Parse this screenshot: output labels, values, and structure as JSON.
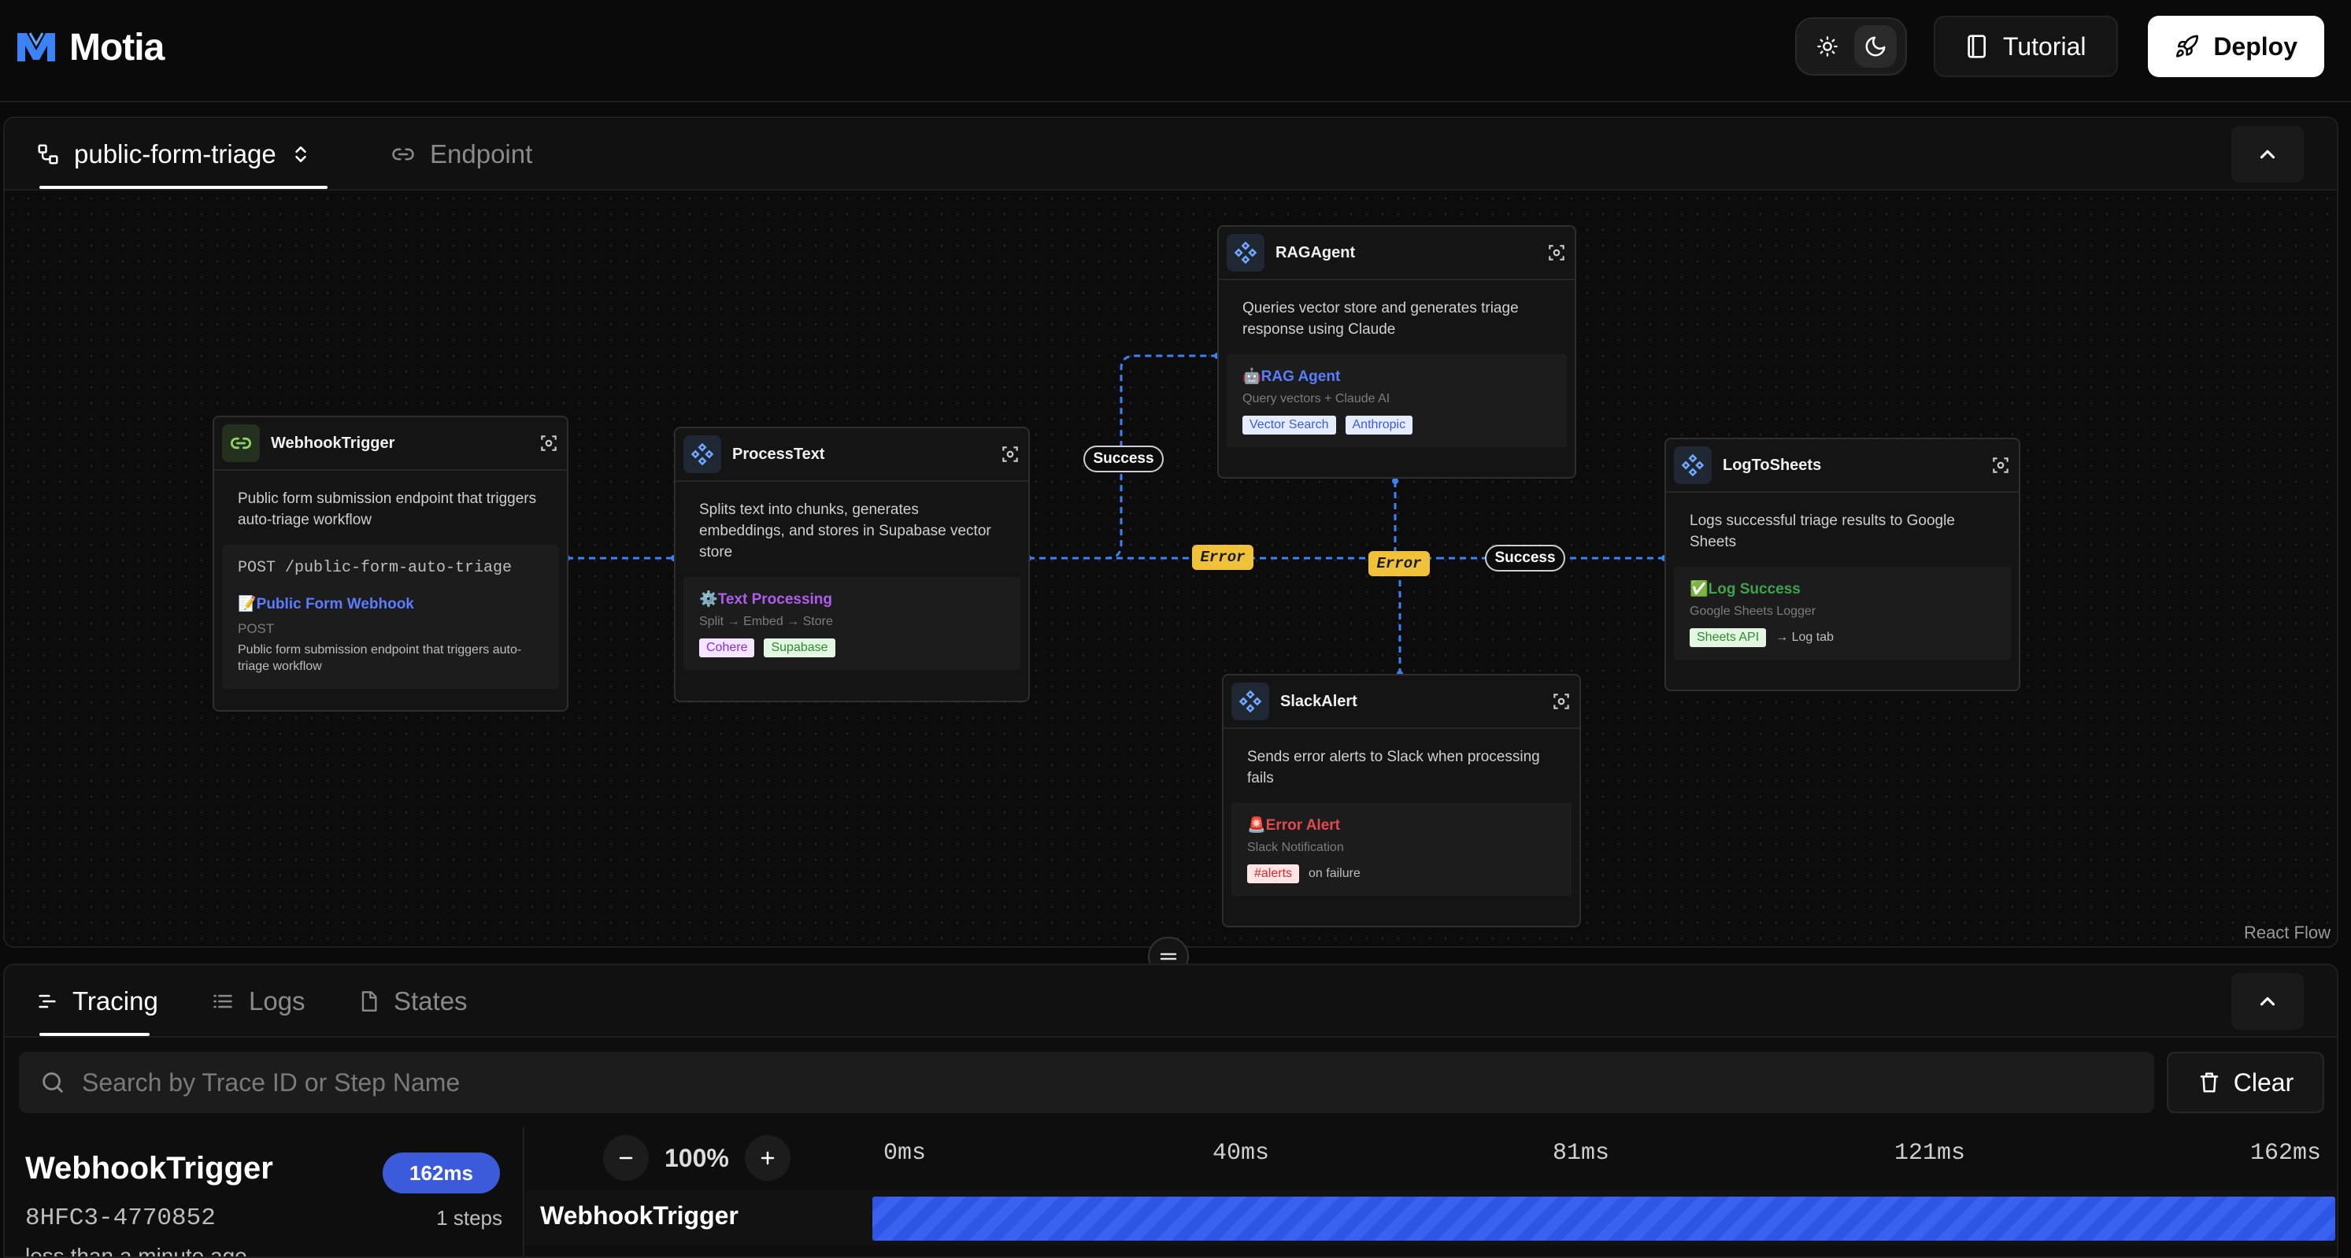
{
  "app": {
    "name": "Motia",
    "tutorial_label": "Tutorial",
    "deploy_label": "Deploy",
    "theme_light_icon": "sun-icon",
    "theme_dark_icon": "moon-icon"
  },
  "flow": {
    "tabs": [
      {
        "label": "public-form-triage",
        "icon": "flow-icon",
        "active": true
      },
      {
        "label": "Endpoint",
        "icon": "link-icon",
        "active": false
      }
    ],
    "react_flow_label": "React Flow",
    "nodes": {
      "webhook": {
        "title": "WebhookTrigger",
        "description": "Public form submission endpoint that triggers auto-triage workflow",
        "route": "POST /public-form-auto-triage",
        "inner_title": "📝Public Form Webhook",
        "inner_method": "POST",
        "inner_desc": "Public form submission endpoint that triggers auto-triage workflow"
      },
      "process": {
        "title": "ProcessText",
        "description": "Splits text into chunks, generates embeddings, and stores in Supabase vector store",
        "inner_title": "⚙️Text Processing",
        "inner_sub": "Split → Embed → Store",
        "tags": [
          "Cohere",
          "Supabase"
        ]
      },
      "rag": {
        "title": "RAGAgent",
        "description": "Queries vector store and generates triage response using Claude",
        "inner_title": "🤖RAG Agent",
        "inner_sub": "Query vectors + Claude AI",
        "tags": [
          "Vector Search",
          "Anthropic"
        ]
      },
      "slack": {
        "title": "SlackAlert",
        "description": "Sends error alerts to Slack when processing fails",
        "inner_title": "🚨Error Alert",
        "inner_sub": "Slack Notification",
        "tag": "#alerts",
        "tag_note": "on failure"
      },
      "sheets": {
        "title": "LogToSheets",
        "description": "Logs successful triage results to Google Sheets",
        "inner_title": "✅Log Success",
        "inner_sub": "Google Sheets Logger",
        "tag": "Sheets API",
        "tag_note": "→ Log tab"
      }
    },
    "edges": {
      "success_1": "Success",
      "error_1": "Error",
      "error_2": "Error",
      "success_2": "Success"
    }
  },
  "bottom": {
    "tabs": [
      {
        "label": "Tracing",
        "icon": "tracing-icon",
        "active": true
      },
      {
        "label": "Logs",
        "icon": "list-icon",
        "active": false
      },
      {
        "label": "States",
        "icon": "file-icon",
        "active": false
      }
    ],
    "search_placeholder": "Search by Trace ID or Step Name",
    "clear_label": "Clear",
    "trace": {
      "name": "WebhookTrigger",
      "duration": "162ms",
      "id": "8HFC3-4770852",
      "steps": "1 steps",
      "time": "less than a minute ago"
    },
    "zoom": "100%",
    "ticks": [
      "0ms",
      "40ms",
      "81ms",
      "121ms",
      "162ms"
    ],
    "row": {
      "label": "WebhookTrigger",
      "progress": 1.0
    }
  },
  "colors": {
    "accent_blue": "#3b5bdb",
    "edge_blue": "#3b82f6",
    "error_yellow": "#f0c23a"
  }
}
